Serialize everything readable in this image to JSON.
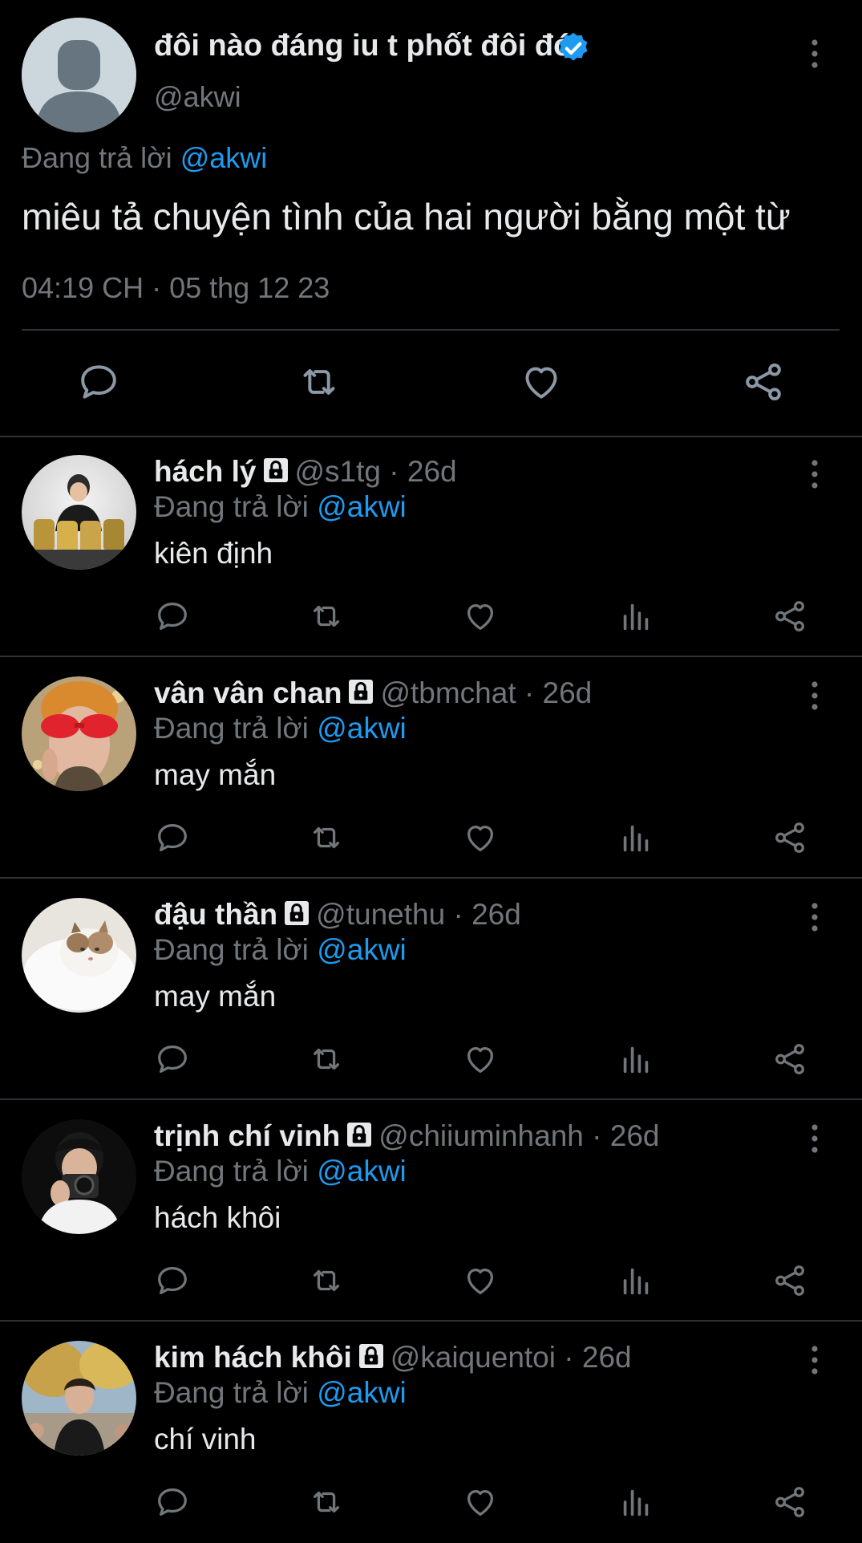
{
  "main_tweet": {
    "author_name": "đôi nào đáng iu t phốt đôi đó",
    "author_handle": "@akwi",
    "replying_prefix": "Đang trả lời",
    "replying_handle": "@akwi",
    "text": "miêu tả chuyện tình của hai người bằng một từ",
    "timestamp": "04:19 CH · 05 thg 12 23",
    "actions": [
      "reply-icon",
      "retweet-icon",
      "like-icon",
      "share-icon"
    ]
  },
  "replies": [
    {
      "name": "hách lý",
      "handle": "@s1tg",
      "age": "26d",
      "replying_prefix": "Đang trả lời",
      "replying_handle": "@akwi",
      "text": "kiên định"
    },
    {
      "name": "vân vân chan",
      "handle": "@tbmchat",
      "age": "26d",
      "replying_prefix": "Đang trả lời",
      "replying_handle": "@akwi",
      "text": "may mắn"
    },
    {
      "name": "đậu thần",
      "handle": "@tunethu",
      "age": "26d",
      "replying_prefix": "Đang trả lời",
      "replying_handle": "@akwi",
      "text": "may mắn"
    },
    {
      "name": "trịnh chí vinh",
      "handle": "@chiiuminhanh",
      "age": "26d",
      "replying_prefix": "Đang trả lời",
      "replying_handle": "@akwi",
      "text": "hách khôi"
    },
    {
      "name": "kim hách khôi",
      "handle": "@kaiquentoi",
      "age": "26d",
      "replying_prefix": "Đang trả lời",
      "replying_handle": "@akwi",
      "text": "chí vinh"
    }
  ],
  "reply_actions": [
    "reply-icon",
    "retweet-icon",
    "like-icon",
    "views-icon",
    "share-icon"
  ],
  "colors": {
    "background": "#000000",
    "text": "#e7e9ea",
    "muted": "#71767b",
    "link": "#1d9bf0",
    "divider": "#2f3336"
  }
}
